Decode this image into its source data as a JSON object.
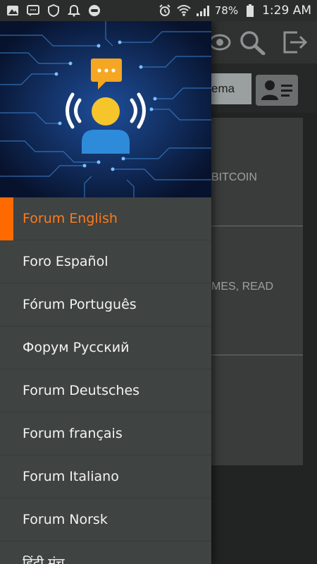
{
  "status_bar": {
    "battery": "78%",
    "time": "1:29 AM",
    "left_icons": [
      "app-icon",
      "message-icon",
      "shield-icon",
      "bell-icon",
      "game-controller-icon"
    ],
    "right_icons": [
      "alarm-icon",
      "wifi-icon",
      "signal-icon",
      "battery-icon"
    ]
  },
  "background": {
    "search_value": "ema",
    "card_texts": [
      "BITCOIN",
      "MES, READ"
    ],
    "toolbar_icons": [
      "eye-icon",
      "search-icon",
      "logout-icon"
    ]
  },
  "drawer": {
    "header_icons": [
      "chat-bubble-icon",
      "broadcast-person-icon"
    ],
    "menu": [
      {
        "label": "Forum English",
        "active": true
      },
      {
        "label": "Foro Español",
        "active": false
      },
      {
        "label": "Fórum Português",
        "active": false
      },
      {
        "label": "Форум Русский",
        "active": false
      },
      {
        "label": "Forum Deutsches",
        "active": false
      },
      {
        "label": "Forum français",
        "active": false
      },
      {
        "label": "Forum Italiano",
        "active": false
      },
      {
        "label": "Forum Norsk",
        "active": false
      },
      {
        "label": "हिंदी मंच",
        "active": false
      }
    ]
  },
  "colors": {
    "accent": "#ff6a00",
    "drawer_bg": "#3f4342",
    "header_bg": "#0a1836"
  }
}
